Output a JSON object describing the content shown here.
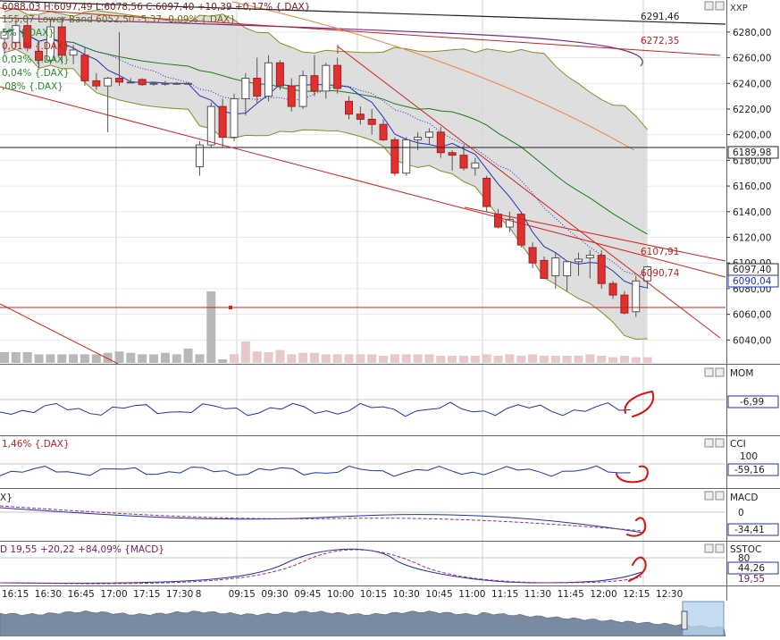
{
  "colors": {
    "up_candle": "#ffffff",
    "down_candle": "#e03030",
    "candle_outline": "#555555",
    "bollinger_fill": "#d8d8d8",
    "bollinger_band": "#8a8a2a",
    "ma_fast": "#2030c0",
    "ma_medium": "#1a7a1a",
    "ma_slow": "#7a2a8a",
    "ma_orange": "#f08040",
    "trendline": "#d02020",
    "hline_black": "#222222",
    "volume": "#b8b8b8",
    "indicator": "#2030b0",
    "signal": "#a03070",
    "annotation": "#e01010",
    "grid": "#c8d8c8"
  },
  "header": {
    "ohlc_line": "6088,03 H:6097,49 L:6078,56 C:6097,40 +10,39 +0,17% {.DAX}",
    "band_line": "155,07 Lower Band 6052,50 -5,37 -0,09% {.DAX}",
    "ma_lines": [
      "5% {.DAX}",
      "0,01% {.DAX}",
      "0,03% {.DAX}",
      "0,04% {.DAX}",
      ",08% {.DAX}"
    ],
    "symbol": "XXP"
  },
  "price_axis": {
    "ticks": [
      "6280,00",
      "6260,00",
      "6240,00",
      "6220,00",
      "6200,00",
      "6180,00",
      "6160,00",
      "6140,00",
      "6120,00",
      "6100,00",
      "6080,00",
      "6060,00",
      "6040,00"
    ],
    "current_price_label": "6097,40",
    "ma_price_label": "6090,04",
    "hline_label": "6189,98"
  },
  "chart_labels": {
    "level_6291": "6291,46",
    "level_6272": "6272,35",
    "level_6107": "6107,91",
    "level_6090": "6090,74"
  },
  "panels": {
    "mom": {
      "name": "MOM",
      "value": "-6,99"
    },
    "cci": {
      "name": "CCI",
      "header": "1,46% {.DAX}",
      "level": "100",
      "value": "-59,16"
    },
    "macd": {
      "name": "MACD",
      "header": "X}",
      "level": "0",
      "value": "-34,41"
    },
    "sstoc": {
      "name": "SSTOC",
      "header": "D 19,55 +20,22 +84,09% {MACD}",
      "level_80": "80",
      "value": "44,26",
      "value2": "19,55"
    }
  },
  "time_axis": {
    "labels": [
      "16:15",
      "16:30",
      "16:45",
      "17:00",
      "17:15",
      "17:30",
      "8",
      "09:15",
      "09:30",
      "09:45",
      "10:00",
      "10:15",
      "10:30",
      "10:45",
      "11:00",
      "11:15",
      "11:30",
      "11:45",
      "12:00",
      "12:15",
      "12:30"
    ]
  },
  "chart_data": {
    "type": "candlestick",
    "price_range": [
      6027,
      6298
    ],
    "candles": [
      {
        "o": 6275,
        "h": 6282,
        "l": 6262,
        "c": 6280
      },
      {
        "o": 6272,
        "h": 6290,
        "l": 6268,
        "c": 6285
      },
      {
        "o": 6285,
        "h": 6292,
        "l": 6265,
        "c": 6268
      },
      {
        "o": 6265,
        "h": 6272,
        "l": 6252,
        "c": 6258
      },
      {
        "o": 6258,
        "h": 6290,
        "l": 6255,
        "c": 6284
      },
      {
        "o": 6284,
        "h": 6292,
        "l": 6255,
        "c": 6262
      },
      {
        "o": 6262,
        "h": 6270,
        "l": 6255,
        "c": 6266
      },
      {
        "o": 6262,
        "h": 6268,
        "l": 6238,
        "c": 6242
      },
      {
        "o": 6242,
        "h": 6248,
        "l": 6235,
        "c": 6238
      },
      {
        "o": 6238,
        "h": 6245,
        "l": 6202,
        "c": 6244
      },
      {
        "o": 6244,
        "h": 6280,
        "l": 6238,
        "c": 6241
      },
      {
        "o": 6241,
        "h": 6244,
        "l": 6240,
        "c": 6241
      },
      {
        "o": 6243,
        "h": 6244,
        "l": 6238,
        "c": 6239
      },
      {
        "o": 6240,
        "h": 6241,
        "l": 6238,
        "c": 6240
      },
      {
        "o": 6240,
        "h": 6242,
        "l": 6238,
        "c": 6240
      },
      {
        "o": 6240,
        "h": 6241,
        "l": 6239,
        "c": 6240
      },
      {
        "o": 6240,
        "h": 6241,
        "l": 6239,
        "c": 6240
      },
      {
        "o": 6175,
        "h": 6195,
        "l": 6168,
        "c": 6192
      },
      {
        "o": 6192,
        "h": 6225,
        "l": 6190,
        "c": 6222
      },
      {
        "o": 6222,
        "h": 6228,
        "l": 6190,
        "c": 6198
      },
      {
        "o": 6198,
        "h": 6232,
        "l": 6195,
        "c": 6228
      },
      {
        "o": 6228,
        "h": 6248,
        "l": 6215,
        "c": 6244
      },
      {
        "o": 6244,
        "h": 6260,
        "l": 6225,
        "c": 6230
      },
      {
        "o": 6230,
        "h": 6262,
        "l": 6226,
        "c": 6256
      },
      {
        "o": 6256,
        "h": 6258,
        "l": 6235,
        "c": 6238
      },
      {
        "o": 6238,
        "h": 6244,
        "l": 6218,
        "c": 6222
      },
      {
        "o": 6222,
        "h": 6250,
        "l": 6220,
        "c": 6246
      },
      {
        "o": 6246,
        "h": 6262,
        "l": 6230,
        "c": 6234
      },
      {
        "o": 6234,
        "h": 6256,
        "l": 6228,
        "c": 6254
      },
      {
        "o": 6254,
        "h": 6260,
        "l": 6232,
        "c": 6236
      },
      {
        "o": 6226,
        "h": 6230,
        "l": 6212,
        "c": 6216
      },
      {
        "o": 6216,
        "h": 6222,
        "l": 6208,
        "c": 6212
      },
      {
        "o": 6212,
        "h": 6220,
        "l": 6200,
        "c": 6208
      },
      {
        "o": 6208,
        "h": 6212,
        "l": 6195,
        "c": 6196
      },
      {
        "o": 6196,
        "h": 6198,
        "l": 6168,
        "c": 6170
      },
      {
        "o": 6170,
        "h": 6198,
        "l": 6168,
        "c": 6196
      },
      {
        "o": 6196,
        "h": 6202,
        "l": 6188,
        "c": 6198
      },
      {
        "o": 6198,
        "h": 6205,
        "l": 6192,
        "c": 6202
      },
      {
        "o": 6202,
        "h": 6206,
        "l": 6182,
        "c": 6186
      },
      {
        "o": 6186,
        "h": 6188,
        "l": 6172,
        "c": 6184
      },
      {
        "o": 6184,
        "h": 6192,
        "l": 6172,
        "c": 6174
      },
      {
        "o": 6174,
        "h": 6182,
        "l": 6168,
        "c": 6178
      },
      {
        "o": 6166,
        "h": 6168,
        "l": 6140,
        "c": 6144
      },
      {
        "o": 6138,
        "h": 6142,
        "l": 6127,
        "c": 6128
      },
      {
        "o": 6128,
        "h": 6140,
        "l": 6124,
        "c": 6134
      },
      {
        "o": 6138,
        "h": 6140,
        "l": 6112,
        "c": 6114
      },
      {
        "o": 6112,
        "h": 6116,
        "l": 6096,
        "c": 6100
      },
      {
        "o": 6102,
        "h": 6105,
        "l": 6088,
        "c": 6088
      },
      {
        "o": 6090,
        "h": 6108,
        "l": 6080,
        "c": 6104
      },
      {
        "o": 6090,
        "h": 6102,
        "l": 6078,
        "c": 6101
      },
      {
        "o": 6101,
        "h": 6108,
        "l": 6090,
        "c": 6103
      },
      {
        "o": 6104,
        "h": 6110,
        "l": 6088,
        "c": 6106
      },
      {
        "o": 6106,
        "h": 6110,
        "l": 6080,
        "c": 6084
      },
      {
        "o": 6084,
        "h": 6086,
        "l": 6072,
        "c": 6075
      },
      {
        "o": 6075,
        "h": 6078,
        "l": 6060,
        "c": 6061
      },
      {
        "o": 6062,
        "h": 6090,
        "l": 6058,
        "c": 6086
      },
      {
        "o": 6086,
        "h": 6098,
        "l": 6080,
        "c": 6097
      }
    ],
    "volume_relative": [
      0.15,
      0.15,
      0.15,
      0.12,
      0.12,
      0.12,
      0.12,
      0.12,
      0.12,
      0.14,
      0.16,
      0.14,
      0.12,
      0.12,
      0.14,
      0.12,
      0.2,
      0.12,
      1.0,
      0.05,
      0.12,
      0.3,
      0.16,
      0.15,
      0.18,
      0.12,
      0.14,
      0.14,
      0.12,
      0.12,
      0.12,
      0.12,
      0.12,
      0.1,
      0.12,
      0.12,
      0.12,
      0.12,
      0.1,
      0.1,
      0.1,
      0.1,
      0.12,
      0.1,
      0.12,
      0.1,
      0.12,
      0.1,
      0.1,
      0.1,
      0.1,
      0.12,
      0.1,
      0.08,
      0.1,
      0.08,
      0.08
    ]
  }
}
